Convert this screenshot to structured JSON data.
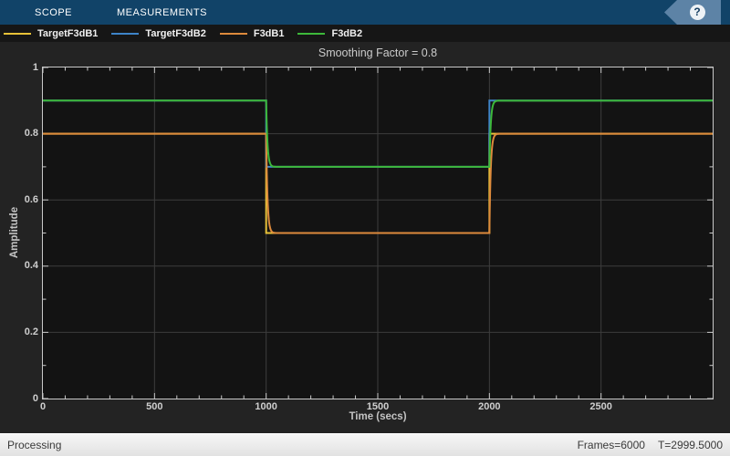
{
  "toolbar": {
    "tabs": [
      {
        "label": "SCOPE"
      },
      {
        "label": "MEASUREMENTS"
      }
    ],
    "help_label": "?"
  },
  "legend": {
    "items": [
      {
        "label": "TargetF3dB1",
        "color": "#e7c138"
      },
      {
        "label": "TargetF3dB2",
        "color": "#3e84c8"
      },
      {
        "label": "F3dB1",
        "color": "#dd8a3c"
      },
      {
        "label": "F3dB2",
        "color": "#3db83a"
      }
    ]
  },
  "chart_data": {
    "type": "line",
    "title": "Smoothing Factor = 0.8",
    "xlabel": "Time (secs)",
    "ylabel": "Amplitude",
    "xlim": [
      0,
      3000
    ],
    "ylim": [
      0,
      1
    ],
    "grid": true,
    "legend_position": "top",
    "smoothing_factor": 0.8,
    "x_ticks": {
      "major": [
        {
          "t": 0,
          "label": "0"
        },
        {
          "t": 500,
          "label": "500"
        },
        {
          "t": 1000,
          "label": "1000"
        },
        {
          "t": 1500,
          "label": "1500"
        },
        {
          "t": 2000,
          "label": "2000"
        },
        {
          "t": 2500,
          "label": "2500"
        }
      ],
      "minor_step": 100
    },
    "y_ticks": {
      "major": [
        {
          "v": 0,
          "label": "0"
        },
        {
          "v": 0.2,
          "label": "0.2"
        },
        {
          "v": 0.4,
          "label": "0.4"
        },
        {
          "v": 0.6,
          "label": "0.6"
        },
        {
          "v": 0.8,
          "label": "0.8"
        },
        {
          "v": 1,
          "label": "1"
        }
      ],
      "minor_step": 0.1
    },
    "series": [
      {
        "name": "TargetF3dB1",
        "color": "#e7c138",
        "style": "step",
        "points": [
          [
            0,
            0.8
          ],
          [
            1000,
            0.8
          ],
          [
            1000,
            0.5
          ],
          [
            2000,
            0.5
          ],
          [
            2000,
            0.8
          ],
          [
            3000,
            0.8
          ]
        ]
      },
      {
        "name": "TargetF3dB2",
        "color": "#3e84c8",
        "style": "step",
        "points": [
          [
            0,
            0.9
          ],
          [
            1000,
            0.9
          ],
          [
            1000,
            0.7
          ],
          [
            2000,
            0.7
          ],
          [
            2000,
            0.9
          ],
          [
            3000,
            0.9
          ]
        ]
      },
      {
        "name": "F3dB1",
        "color": "#dd8a3c",
        "style": "smoothed",
        "tau": 6,
        "points": [
          [
            0,
            0.8
          ],
          [
            1000,
            0.8
          ],
          [
            1000,
            0.5
          ],
          [
            2000,
            0.5
          ],
          [
            2000,
            0.8
          ],
          [
            3000,
            0.8
          ]
        ]
      },
      {
        "name": "F3dB2",
        "color": "#3db83a",
        "style": "smoothed",
        "tau": 6,
        "points": [
          [
            0,
            0.9
          ],
          [
            1000,
            0.9
          ],
          [
            1000,
            0.7
          ],
          [
            2000,
            0.7
          ],
          [
            2000,
            0.9
          ],
          [
            3000,
            0.9
          ]
        ]
      }
    ],
    "colors": {
      "plot_bg": "#131313",
      "figure_bg": "#232323",
      "grid": "#3d3d3d",
      "axis": "#c9c9c9",
      "tick_label": "#cfcfcf"
    }
  },
  "status_bar": {
    "left": "Processing",
    "frames": "Frames=6000",
    "time": "T=2999.5000"
  }
}
